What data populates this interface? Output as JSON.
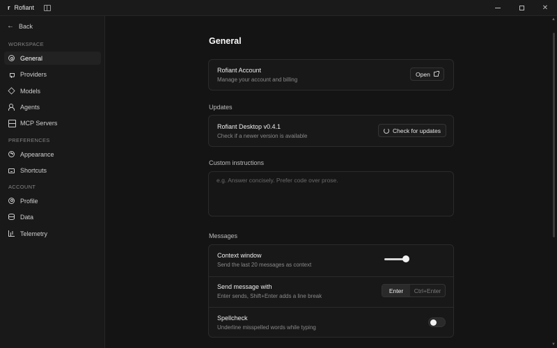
{
  "titlebar": {
    "app_name": "Rofiant",
    "logo_glyph": "r"
  },
  "sidebar": {
    "back_label": "Back",
    "sections": [
      {
        "title": "WORKSPACE",
        "items": [
          {
            "label": "General",
            "icon": "gear-icon",
            "active": true
          },
          {
            "label": "Providers",
            "icon": "plug-icon"
          },
          {
            "label": "Models",
            "icon": "cube-icon"
          },
          {
            "label": "Agents",
            "icon": "users-icon"
          },
          {
            "label": "MCP Servers",
            "icon": "server-icon"
          }
        ]
      },
      {
        "title": "PREFERENCES",
        "items": [
          {
            "label": "Appearance",
            "icon": "palette-icon"
          },
          {
            "label": "Shortcuts",
            "icon": "keyboard-icon"
          }
        ]
      },
      {
        "title": "ACCOUNT",
        "items": [
          {
            "label": "Profile",
            "icon": "profile-icon"
          },
          {
            "label": "Data",
            "icon": "database-icon"
          },
          {
            "label": "Telemetry",
            "icon": "chart-icon"
          }
        ]
      }
    ]
  },
  "main": {
    "page_title": "General",
    "account": {
      "title": "Rofiant Account",
      "description": "Manage your account and billing",
      "button_label": "Open"
    },
    "updates": {
      "group_label": "Updates",
      "title": "Rofiant Desktop v0.4.1",
      "description": "Check if a newer version is available",
      "button_label": "Check for updates"
    },
    "custom_instructions": {
      "group_label": "Custom instructions",
      "placeholder": "e.g. Answer concisely. Prefer code over prose."
    },
    "messages": {
      "group_label": "Messages",
      "context_window": {
        "title": "Context window",
        "description": "Send the last 20 messages as context",
        "slider_fraction": 0.9
      },
      "send_with": {
        "title": "Send message with",
        "description": "Enter sends, Shift+Enter adds a line break",
        "options": [
          "Enter",
          "Ctrl+Enter"
        ],
        "selected": "Enter"
      },
      "spellcheck": {
        "title": "Spellcheck",
        "description": "Underline misspelled words while typing",
        "enabled": false
      }
    }
  },
  "colors": {
    "background": "#141414",
    "sidebar": "#191919",
    "card": "#181818",
    "border": "#2b2b2b",
    "text": "#f0f0f0",
    "muted": "#8a8a8a"
  }
}
